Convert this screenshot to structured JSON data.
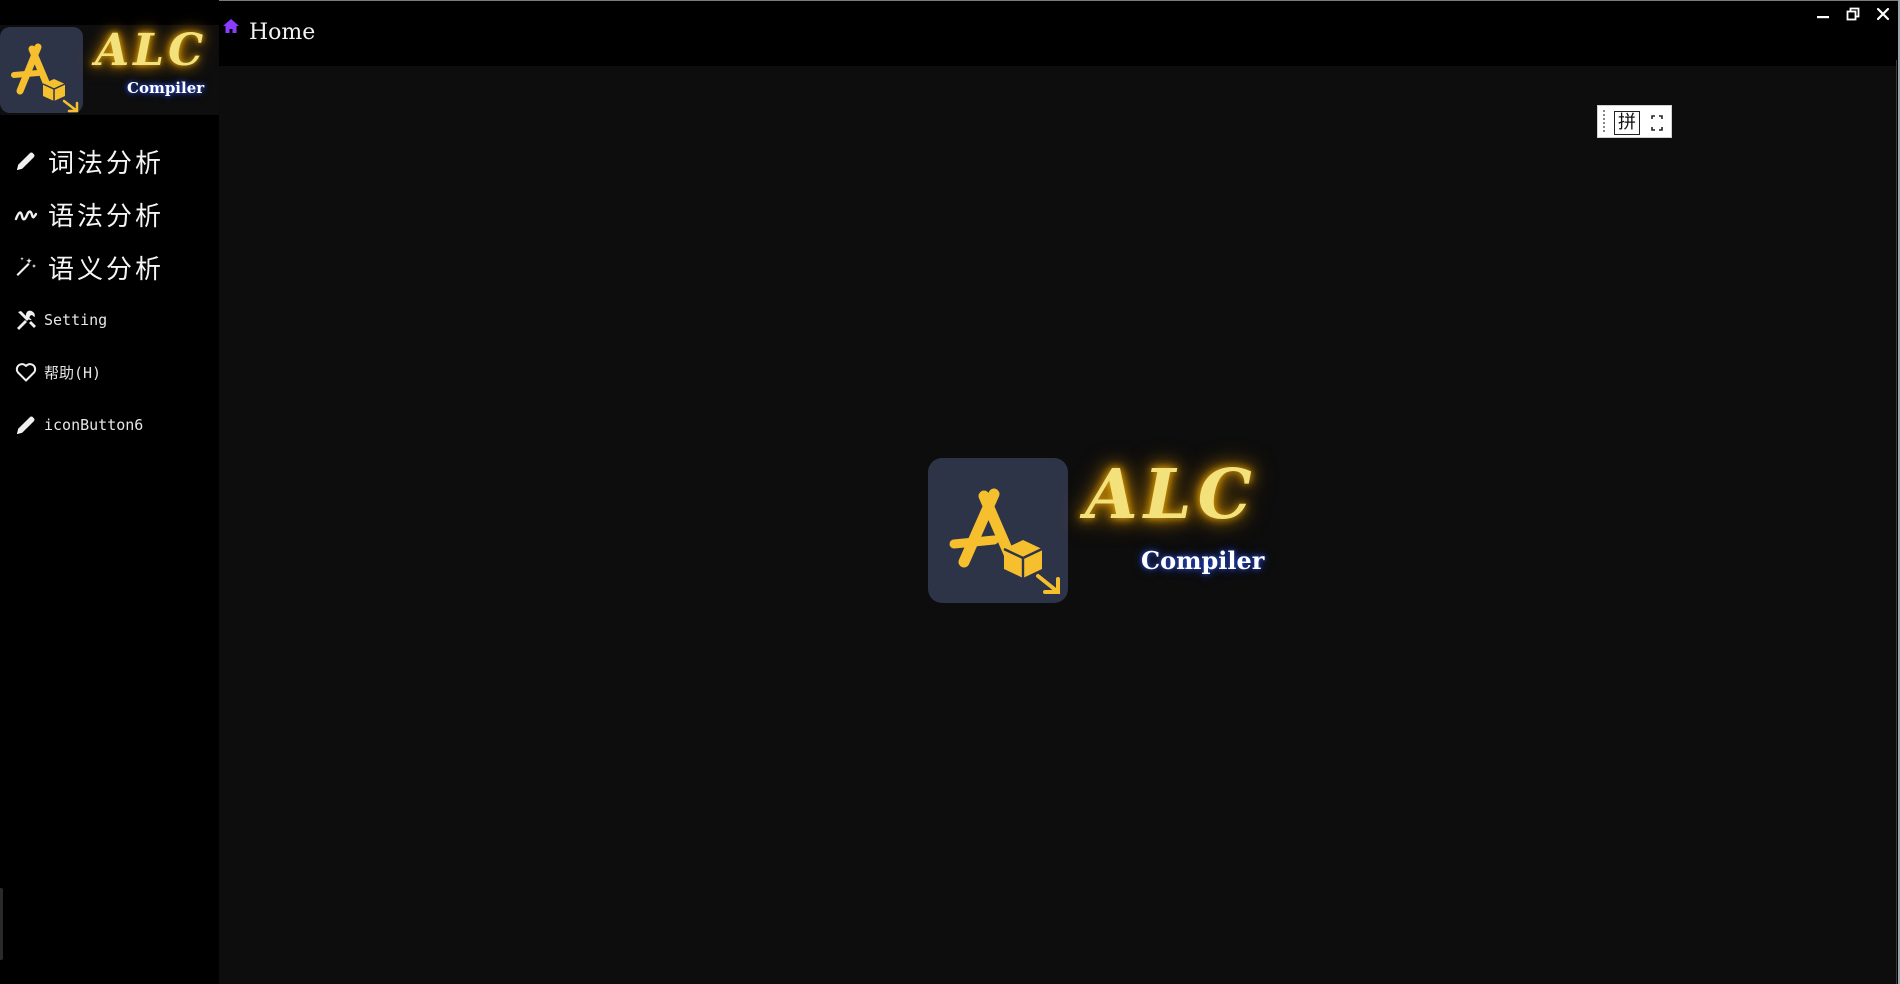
{
  "app": {
    "brand_name": "ALC",
    "brand_sub": "Compiler"
  },
  "header": {
    "title": "Home",
    "home_icon": "home-icon",
    "accent_color": "#8a3dff"
  },
  "window_controls": [
    {
      "name": "minimize",
      "icon": "minimize-icon"
    },
    {
      "name": "restore",
      "icon": "restore-icon"
    },
    {
      "name": "close",
      "icon": "close-icon"
    }
  ],
  "sidebar": {
    "items": [
      {
        "label": "词法分析",
        "icon": "pencil-icon"
      },
      {
        "label": "语法分析",
        "icon": "squiggle-icon"
      },
      {
        "label": "语义分析",
        "icon": "magic-wand-icon"
      },
      {
        "label": "Setting",
        "icon": "tools-icon"
      },
      {
        "label": "帮助(H)",
        "icon": "heart-icon"
      },
      {
        "label": "iconButton6",
        "icon": "pencil-icon"
      }
    ]
  },
  "ime_toolbar": {
    "mode_label": "拼"
  },
  "center": {
    "brand_name": "ALC",
    "brand_sub": "Compiler"
  },
  "colors": {
    "sidebar_bg": "#000000",
    "content_bg": "#0d0d0d",
    "logo_tile": "#2e3447",
    "logo_yellow": "#f5bf2e",
    "glow_gold": "#e1a20a",
    "glow_blue": "#2a4bd7"
  }
}
